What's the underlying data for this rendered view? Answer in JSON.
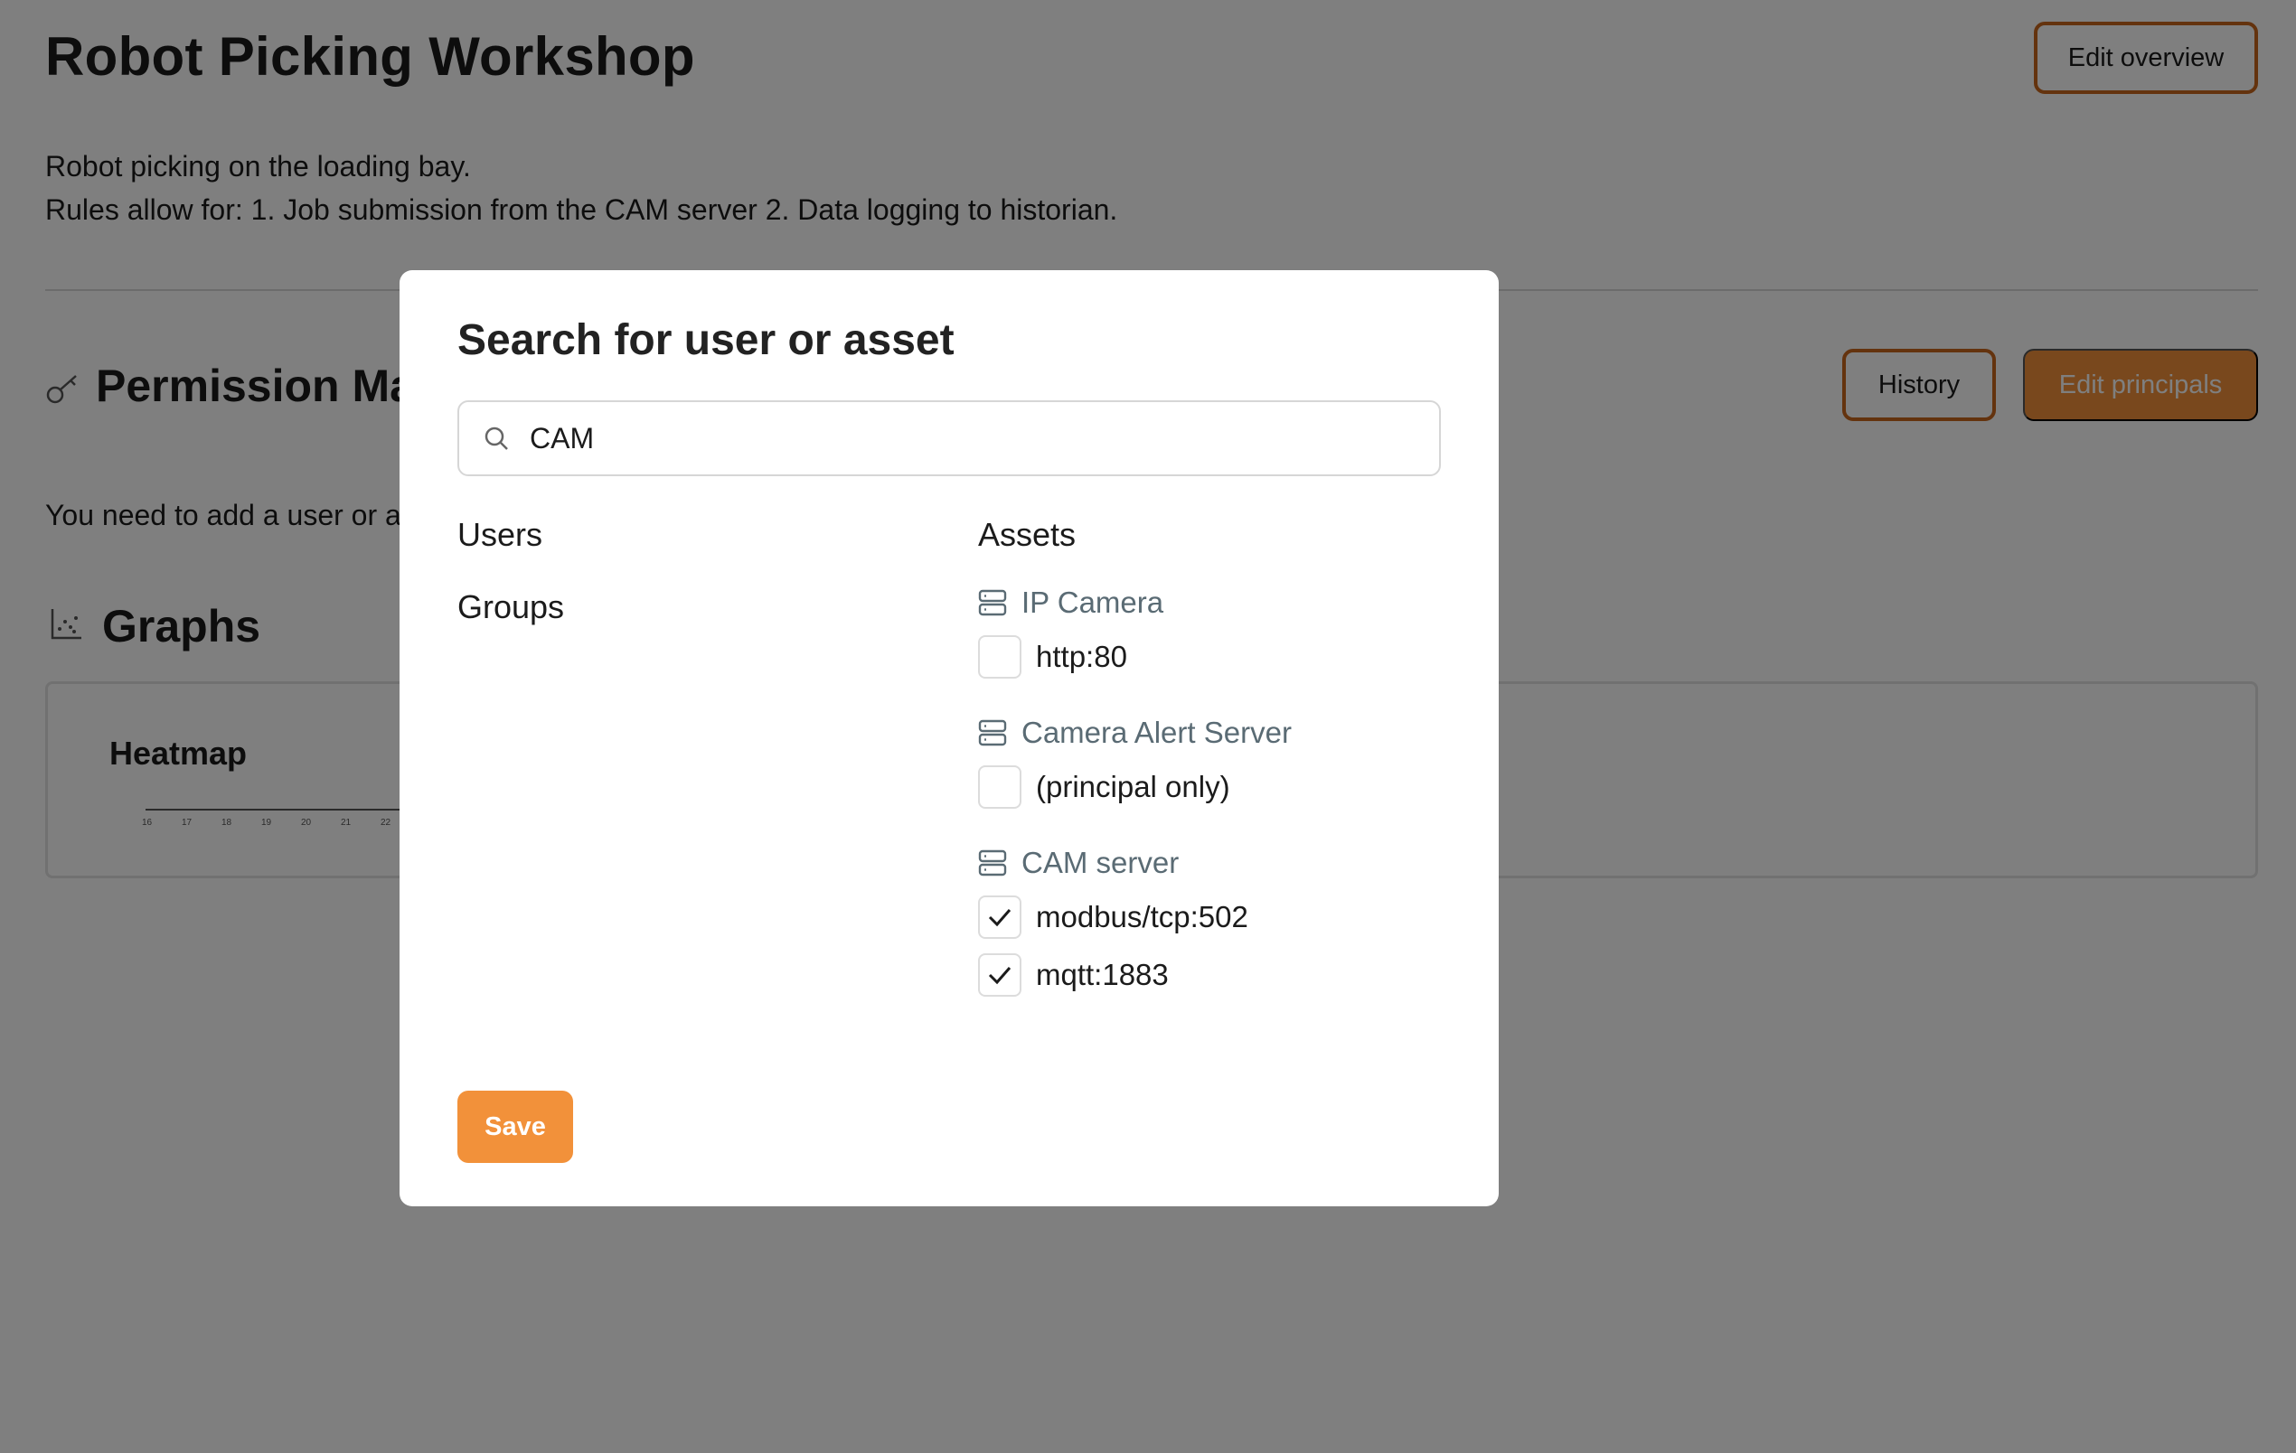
{
  "page": {
    "title": "Robot Picking Workshop",
    "edit_overview_label": "Edit overview",
    "description_line1": "Robot picking on the loading bay.",
    "description_line2": "Rules allow for: 1. Job submission from the CAM server 2. Data logging to historian.",
    "permission_title": "Permission Matrix",
    "history_label": "History",
    "edit_principals_label": "Edit principals",
    "need_text": "You need to add a user or asset",
    "graphs_title": "Graphs",
    "heatmap_title": "Heatmap",
    "heatmap_ticks": [
      "16",
      "17",
      "18",
      "19",
      "20",
      "21",
      "22"
    ]
  },
  "modal": {
    "title": "Search for user or asset",
    "search": {
      "value": "CAM",
      "icon": "search-icon"
    },
    "users_heading": "Users",
    "groups_heading": "Groups",
    "assets_heading": "Assets",
    "assets": [
      {
        "name": "IP Camera",
        "icon": "server-icon",
        "ports": [
          {
            "label": "http:80",
            "checked": false
          }
        ]
      },
      {
        "name": "Camera Alert Server",
        "icon": "server-icon",
        "ports": [
          {
            "label": "(principal only)",
            "checked": false
          }
        ]
      },
      {
        "name": "CAM server",
        "icon": "server-icon",
        "ports": [
          {
            "label": "modbus/tcp:502",
            "checked": true
          },
          {
            "label": "mqtt:1883",
            "checked": true
          }
        ]
      }
    ],
    "save_label": "Save"
  },
  "colors": {
    "accent": "#f2913a",
    "accent_border": "#c8661c",
    "overlay": "rgba(0,0,0,0.5)",
    "asset_text": "#5a6b74"
  }
}
